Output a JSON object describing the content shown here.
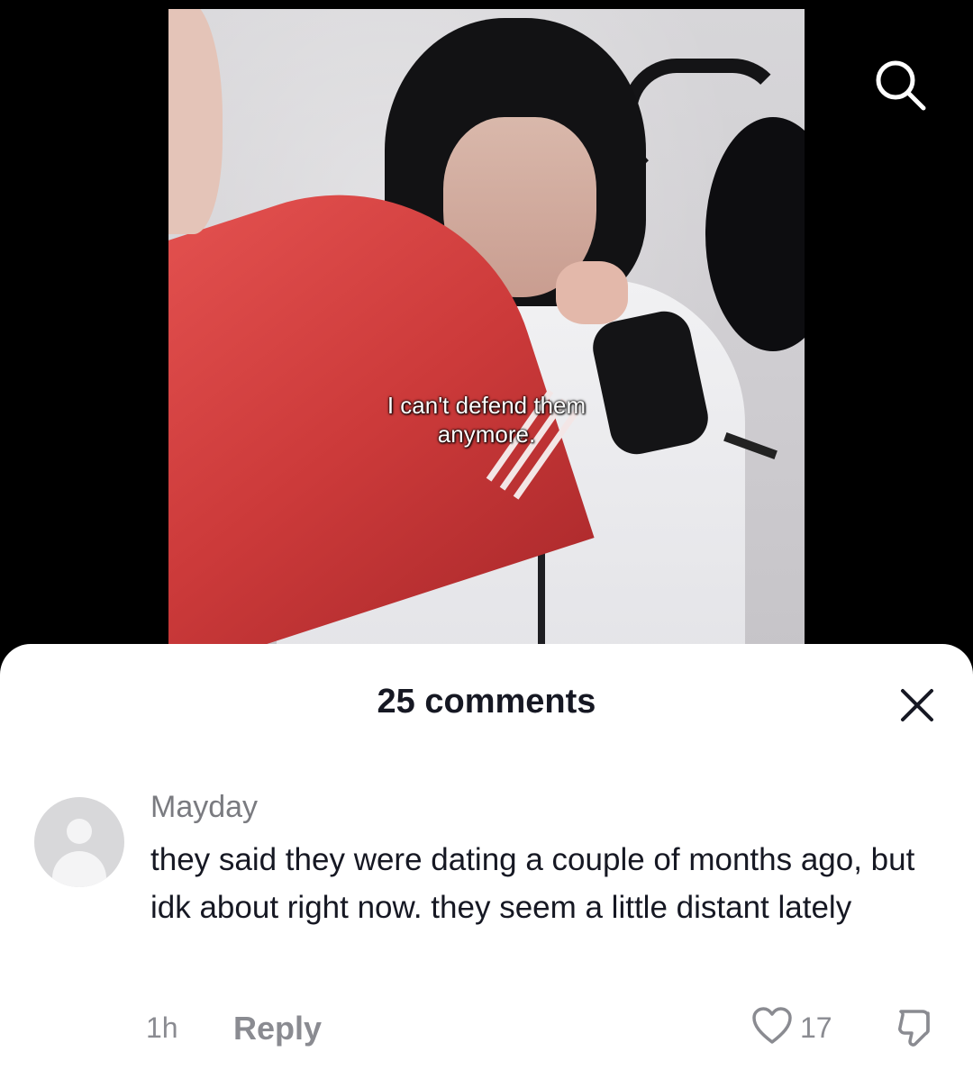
{
  "video": {
    "caption": "I can't defend them\nanymore."
  },
  "icons": {
    "search": "search-icon",
    "close": "close-icon",
    "like": "heart-icon",
    "dislike": "thumbs-down-icon",
    "avatar": "default-avatar-icon"
  },
  "comments_panel": {
    "title": "25 comments"
  },
  "comment": {
    "username": "Mayday",
    "text": "they said they were dating a couple of months ago, but idk about right now. they seem a little distant lately",
    "time": "1h",
    "reply_label": "Reply",
    "like_count": "17"
  },
  "colors": {
    "sheet_background": "#ffffff",
    "primary_text": "#161823",
    "secondary_text": "#8a8b91",
    "screen_background": "#000000"
  }
}
